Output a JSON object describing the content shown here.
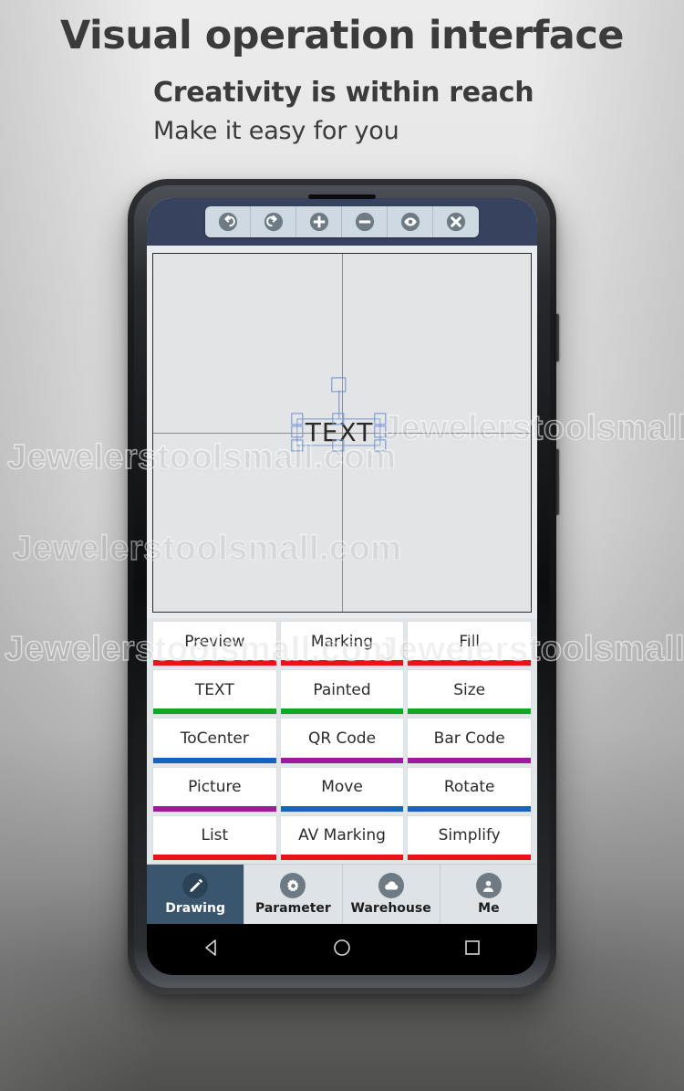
{
  "headings": {
    "title": "Visual operation interface",
    "subtitle1": "Creativity is within reach",
    "subtitle2": "Make it easy for you"
  },
  "watermark": {
    "text": "Jewelerstoolsmall.com"
  },
  "colors": {
    "navy": "#36425e",
    "nav_active": "#3a566f",
    "red": "#e8121b",
    "green": "#13a72a",
    "blue": "#1565c0",
    "purple": "#a01aa0",
    "canvas_bg": "#e2e4e6",
    "selection": "#6d8fcf"
  },
  "toolbar": {
    "items": [
      {
        "name": "undo-icon",
        "label": "Undo"
      },
      {
        "name": "redo-icon",
        "label": "Redo"
      },
      {
        "name": "zoom-in-icon",
        "label": "Zoom In"
      },
      {
        "name": "zoom-out-icon",
        "label": "Zoom Out"
      },
      {
        "name": "eye-icon",
        "label": "Preview"
      },
      {
        "name": "close-icon",
        "label": "Close"
      }
    ]
  },
  "canvas": {
    "object_text": "TEXT",
    "crosshair": true,
    "selected": true
  },
  "menu": {
    "rows": [
      {
        "buttons": [
          {
            "label": "Preview",
            "color": "#e8121b"
          },
          {
            "label": "Marking",
            "color": "#e8121b"
          },
          {
            "label": "Fill",
            "color": "#e8121b"
          }
        ]
      },
      {
        "buttons": [
          {
            "label": "TEXT",
            "color": "#13a72a"
          },
          {
            "label": "Painted",
            "color": "#13a72a"
          },
          {
            "label": "Size",
            "color": "#13a72a"
          }
        ]
      },
      {
        "buttons": [
          {
            "label": "ToCenter",
            "color": "#1565c0"
          },
          {
            "label": "QR Code",
            "color": "#a01aa0"
          },
          {
            "label": "Bar Code",
            "color": "#a01aa0"
          }
        ]
      },
      {
        "buttons": [
          {
            "label": "Picture",
            "color": "#a01aa0"
          },
          {
            "label": "Move",
            "color": "#1565c0"
          },
          {
            "label": "Rotate",
            "color": "#1565c0"
          }
        ]
      },
      {
        "buttons": [
          {
            "label": "List",
            "color": "#e8121b"
          },
          {
            "label": "AV Marking",
            "color": "#e8121b"
          },
          {
            "label": "Simplify",
            "color": "#e8121b"
          }
        ]
      }
    ]
  },
  "bottom_nav": {
    "items": [
      {
        "label": "Drawing",
        "icon": "pencil-icon",
        "active": true
      },
      {
        "label": "Parameter",
        "icon": "gear-icon",
        "active": false
      },
      {
        "label": "Warehouse",
        "icon": "cloud-icon",
        "active": false
      },
      {
        "label": "Me",
        "icon": "person-icon",
        "active": false
      }
    ]
  },
  "system_nav": {
    "items": [
      {
        "name": "back-button",
        "label": "Back"
      },
      {
        "name": "home-button",
        "label": "Home"
      },
      {
        "name": "recents-button",
        "label": "Recents"
      }
    ]
  }
}
